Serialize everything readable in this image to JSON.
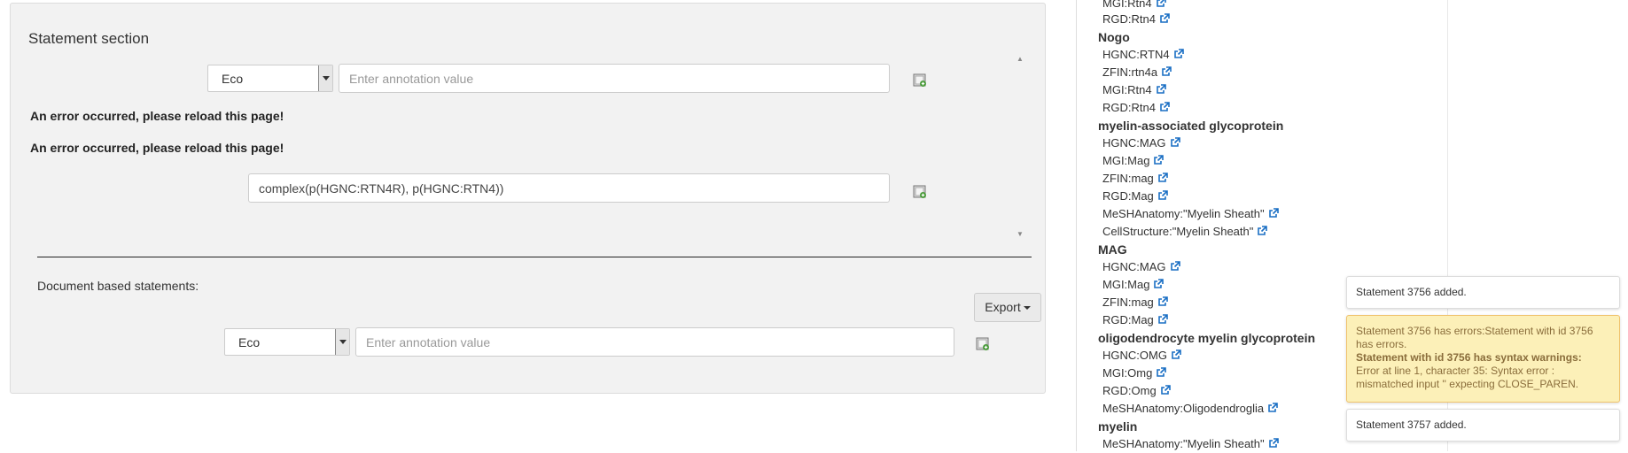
{
  "statement_section": {
    "title": "Statement section",
    "annotation_select": "Eco",
    "annotation_placeholder": "Enter annotation value",
    "errors": [
      "An error occurred, please reload this page!",
      "An error occurred, please reload this page!"
    ],
    "statement_value": "complex(p(HGNC:RTN4R), p(HGNC:RTN4))"
  },
  "document_statements": {
    "label": "Document based statements:",
    "export_label": "Export",
    "annotation_select": "Eco",
    "annotation_placeholder": "Enter annotation value"
  },
  "tree": [
    {
      "text": "MGI:Rtn4",
      "head": false
    },
    {
      "text": "RGD:Rtn4",
      "head": false
    },
    {
      "text": "Nogo",
      "head": true
    },
    {
      "text": "HGNC:RTN4",
      "head": false
    },
    {
      "text": "ZFIN:rtn4a",
      "head": false
    },
    {
      "text": "MGI:Rtn4",
      "head": false
    },
    {
      "text": "RGD:Rtn4",
      "head": false
    },
    {
      "text": "myelin-associated glycoprotein",
      "head": true
    },
    {
      "text": "HGNC:MAG",
      "head": false
    },
    {
      "text": "MGI:Mag",
      "head": false
    },
    {
      "text": "ZFIN:mag",
      "head": false
    },
    {
      "text": "RGD:Mag",
      "head": false
    },
    {
      "text": "MeSHAnatomy:\"Myelin Sheath\"",
      "head": false
    },
    {
      "text": "CellStructure:\"Myelin Sheath\"",
      "head": false
    },
    {
      "text": "MAG",
      "head": true
    },
    {
      "text": "HGNC:MAG",
      "head": false
    },
    {
      "text": "MGI:Mag",
      "head": false
    },
    {
      "text": "ZFIN:mag",
      "head": false
    },
    {
      "text": "RGD:Mag",
      "head": false
    },
    {
      "text": "oligodendrocyte myelin glycoprotein",
      "head": true
    },
    {
      "text": "HGNC:OMG",
      "head": false
    },
    {
      "text": "MGI:Omg",
      "head": false
    },
    {
      "text": "RGD:Omg",
      "head": false
    },
    {
      "text": "MeSHAnatomy:Oligodendroglia",
      "head": false
    },
    {
      "text": "myelin",
      "head": true
    },
    {
      "text": "MeSHAnatomy:\"Myelin Sheath\"",
      "head": false
    }
  ],
  "notifications": {
    "first": "Statement 3756 added.",
    "warning_line1": "Statement 3756 has errors:Statement with id 3756 has errors.",
    "warning_bold": "Statement with id 3756 has syntax warnings:",
    "warning_detail": "Error at line 1, character 35: Syntax error : mismatched input '' expecting CLOSE_PAREN.",
    "last": "Statement 3757 added."
  },
  "colors": {
    "link_icon": "#1a6fc4",
    "warning_bg": "#fcf0b8"
  }
}
